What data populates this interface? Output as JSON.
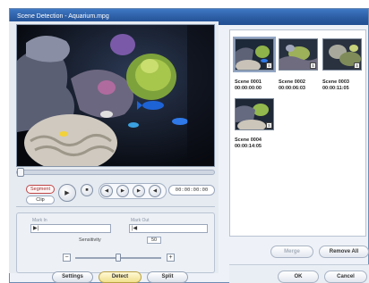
{
  "window": {
    "title": "Scene Detection - Aquarium.mpg"
  },
  "player": {
    "modes": [
      "Segment",
      "Clip"
    ],
    "play_symbol": "▶",
    "stop_symbol": "■",
    "nav_symbols": [
      "◀",
      "▶",
      "▶",
      "◀"
    ],
    "timecode": "00:00:00:00",
    "position": 0.0
  },
  "marks": {
    "mark_in_label": "Mark In",
    "mark_out_label": "Mark Out",
    "in_symbol": "▶|",
    "out_symbol": "|◀"
  },
  "sensitivity": {
    "label": "Sensitivity",
    "value": "50",
    "minus": "−",
    "plus": "+",
    "level": 0.5
  },
  "buttons": {
    "settings": "Settings",
    "detect": "Detect",
    "split": "Split",
    "merge": "Merge",
    "remove_all": "Remove All",
    "ok": "OK",
    "cancel": "Cancel"
  },
  "scenes": [
    {
      "name": "Scene 0001",
      "time": "00:00:00:00",
      "badge": "S"
    },
    {
      "name": "Scene 0002",
      "time": "00:00:06:03",
      "badge": "S"
    },
    {
      "name": "Scene 0003",
      "time": "00:00:11:05",
      "badge": "S"
    },
    {
      "name": "Scene 0004",
      "time": "00:00:14:05",
      "badge": "S"
    }
  ],
  "colors": {
    "titlebar": "#2a5aa0",
    "accent": "#c04646",
    "panel": "#eef2f8"
  }
}
